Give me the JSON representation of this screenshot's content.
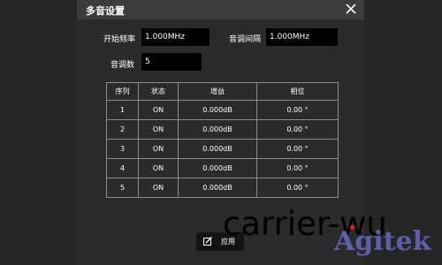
{
  "dialog": {
    "title": "多音设置",
    "close_icon": "close-icon"
  },
  "fields": {
    "start_freq_label": "开始频率",
    "start_freq_value": "1.000MHz",
    "tone_spacing_label": "音调间隔",
    "tone_spacing_value": "1.000MHz",
    "tone_count_label": "音调数",
    "tone_count_value": "5"
  },
  "table": {
    "headers": [
      "序列",
      "状态",
      "增益",
      "相位"
    ],
    "rows": [
      [
        "1",
        "ON",
        "0.000dB",
        "0.00 °"
      ],
      [
        "2",
        "ON",
        "0.000dB",
        "0.00 °"
      ],
      [
        "3",
        "ON",
        "0.000dB",
        "0.00 °"
      ],
      [
        "4",
        "ON",
        "0.000dB",
        "0.00 °"
      ],
      [
        "5",
        "ON",
        "0.000dB",
        "0.00 °"
      ]
    ]
  },
  "apply": {
    "label": "应用",
    "icon": "edit-icon"
  },
  "watermark": {
    "text": "carrier-wu",
    "logo": "Agitek"
  },
  "colors": {
    "background": "#262626",
    "titlebar": "#3c3c3c",
    "input": "#000000",
    "grid": "#8a8a8a",
    "accent_dot": "#e0202a"
  }
}
